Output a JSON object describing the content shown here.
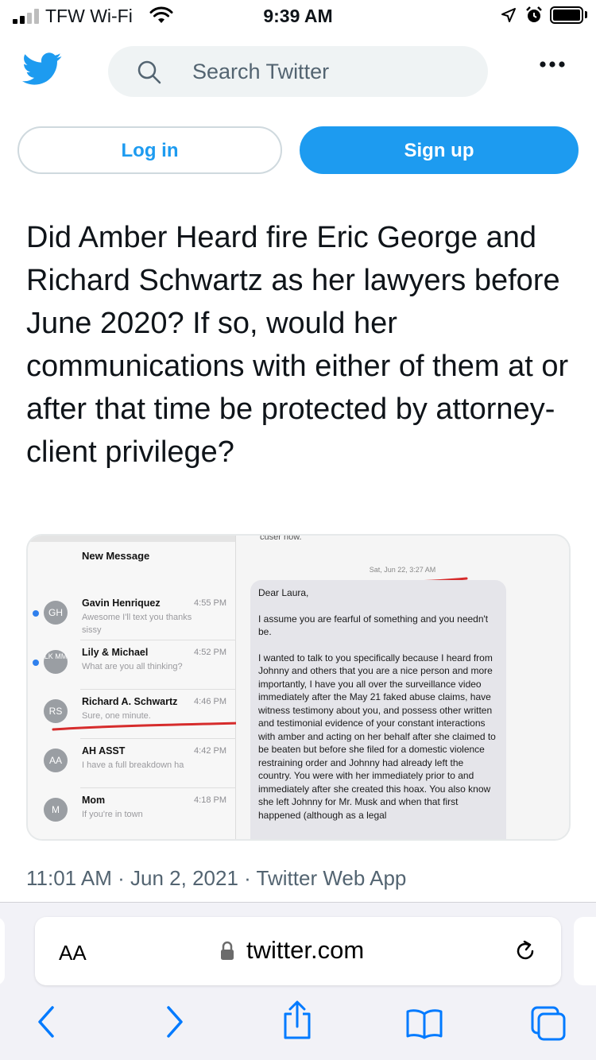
{
  "status_bar": {
    "carrier": "TFW Wi-Fi",
    "time": "9:39 AM",
    "icons": [
      "signal-icon",
      "wifi-icon",
      "location-arrow-icon",
      "alarm-icon",
      "battery-icon"
    ]
  },
  "header": {
    "logo": "twitter-bird-icon",
    "search_placeholder": "Search Twitter",
    "more": "more-icon"
  },
  "auth": {
    "login_label": "Log in",
    "signup_label": "Sign up"
  },
  "tweet": {
    "text": "Did Amber Heard fire Eric George and Richard Schwartz as her lawyers before June 2020? If so, would her communications with either of them at or after that time be protected by attorney-client privilege?",
    "meta": "11:01 AM · Jun 2, 2021 · Twitter Web App"
  },
  "media": {
    "clipped_header": "cuser now.",
    "list_title": "New Message",
    "threads": [
      {
        "initials": "GH",
        "name": "Gavin Henriquez",
        "time": "4:55 PM",
        "preview": "Awesome I'll text you thanks sissy",
        "unread": true
      },
      {
        "initials": "LK MM",
        "name": "Lily & Michael",
        "time": "4:52 PM",
        "preview": "What are you all thinking?",
        "unread": true
      },
      {
        "initials": "RS",
        "name": "Richard A. Schwartz",
        "time": "4:46 PM",
        "preview": "Sure, one minute.",
        "unread": false
      },
      {
        "initials": "AA",
        "name": "AH ASST",
        "time": "4:42 PM",
        "preview": "I have a full breakdown ha",
        "unread": false
      },
      {
        "initials": "M",
        "name": "Mom",
        "time": "4:18 PM",
        "preview": "If you're in town",
        "unread": false
      }
    ],
    "message_date": "Sat, Jun 22, 3:27 AM",
    "message_paragraphs": [
      "Dear Laura,",
      "I assume you are fearful of something and you needn't be.",
      "I wanted to talk to you specifically because I heard from Johnny and others that you are a nice person and more importantly, I  have you all over the surveillance video immediately after the May 21 faked abuse claims, have witness testimony about you, and possess other written and testimonial evidence of your constant interactions with amber and acting on her behalf after she claimed to be beaten but before she filed for a domestic violence restraining order and Johnny had already left the country. You were with her immediately prior to and immediately after she created this hoax. You also know she left Johnny for Mr. Musk and when that first happened (although as a legal"
    ]
  },
  "safari": {
    "aa_label": "AA",
    "url": "twitter.com",
    "toolbar": [
      "back-icon",
      "forward-icon",
      "share-icon",
      "bookmarks-icon",
      "tabs-icon"
    ]
  },
  "colors": {
    "twitter_blue": "#1d9bf0",
    "secondary_text": "#536471",
    "safari_blue": "#007aff",
    "annotation_red": "#d62c2c"
  }
}
